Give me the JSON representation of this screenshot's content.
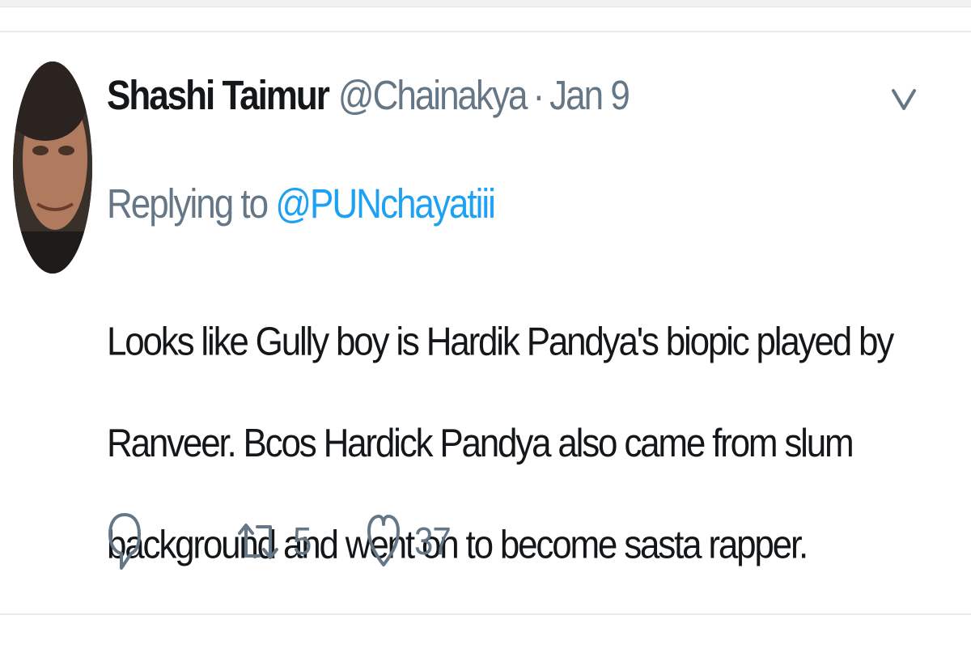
{
  "tweet": {
    "author_name": "Shashi Taimur",
    "author_handle": "@Chainakya",
    "separator": "·",
    "date": "Jan 9",
    "replying_prefix": "Replying to",
    "replying_to": "@PUNchayatiii",
    "text": "Looks like Gully boy is Hardik Pandya's biopic played by Ranveer. Bcos Hardick Pandya also came from slum background and went on to become sasta rapper.",
    "actions": {
      "reply_icon": "speech-bubble-icon",
      "retweet_icon": "retweet-arrows-icon",
      "retweet_count": "5",
      "like_icon": "heart-outline-icon",
      "like_count": "37"
    },
    "menu_icon": "chevron-down-icon"
  },
  "colors": {
    "name": "#14171a",
    "meta": "#657786",
    "link": "#1da1f2",
    "divider": "#e6ecf0"
  }
}
